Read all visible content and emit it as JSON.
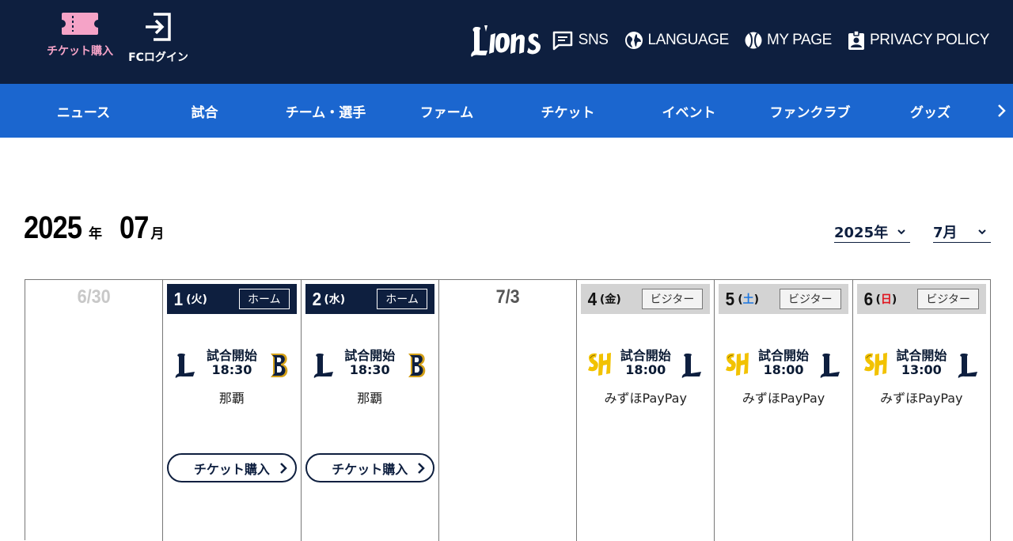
{
  "header": {
    "ticket_label": "チケット購入",
    "fc_login_label": "FCログイン",
    "links": [
      {
        "label": "SNS",
        "icon": "chat-bubble-icon"
      },
      {
        "label": "LANGUAGE",
        "icon": "globe-icon"
      },
      {
        "label": "MY PAGE",
        "icon": "baseball-icon"
      },
      {
        "label": "PRIVACY POLICY",
        "icon": "id-badge-icon"
      }
    ]
  },
  "nav": {
    "items": [
      "ニュース",
      "試合",
      "チーム・選手",
      "ファーム",
      "チケット",
      "イベント",
      "ファンクラブ",
      "グッズ"
    ]
  },
  "month_heading": {
    "year": "2025",
    "year_unit": "年",
    "month": "07",
    "month_unit": "月"
  },
  "selectors": {
    "year": "2025年",
    "month": "7月"
  },
  "colors": {
    "navy": "#0e1f3f",
    "blue": "#1b66cf",
    "pink": "#f5a3c7",
    "saturday": "#1b76e0",
    "sunday": "#e0141e"
  },
  "calendar": {
    "days": [
      {
        "empty_label": "6/30"
      },
      {
        "num": "1",
        "open": "(",
        "dow": "火",
        "close": ")",
        "venue_type": "ホーム",
        "start_label": "試合開始",
        "time": "18:30",
        "stadium": "那覇",
        "button": "チケット購入",
        "left_team": "lions-logo-icon",
        "right_team": "buffaloes-logo-icon"
      },
      {
        "num": "2",
        "open": "(",
        "dow": "水",
        "close": ")",
        "venue_type": "ホーム",
        "start_label": "試合開始",
        "time": "18:30",
        "stadium": "那覇",
        "button": "チケット購入",
        "left_team": "lions-logo-icon",
        "right_team": "buffaloes-logo-icon"
      },
      {
        "empty_label": "7/3"
      },
      {
        "num": "4",
        "open": "(",
        "dow": "金",
        "close": ")",
        "venue_type": "ビジター",
        "start_label": "試合開始",
        "time": "18:00",
        "stadium": "みずほPayPay",
        "left_team": "hawks-logo-icon",
        "right_team": "lions-logo-icon"
      },
      {
        "num": "5",
        "open": "(",
        "dow": "土",
        "close": ")",
        "venue_type": "ビジター",
        "start_label": "試合開始",
        "time": "18:00",
        "stadium": "みずほPayPay",
        "left_team": "hawks-logo-icon",
        "right_team": "lions-logo-icon"
      },
      {
        "num": "6",
        "open": "(",
        "dow": "日",
        "close": ")",
        "venue_type": "ビジター",
        "start_label": "試合開始",
        "time": "13:00",
        "stadium": "みずほPayPay",
        "left_team": "hawks-logo-icon",
        "right_team": "lions-logo-icon"
      }
    ]
  }
}
